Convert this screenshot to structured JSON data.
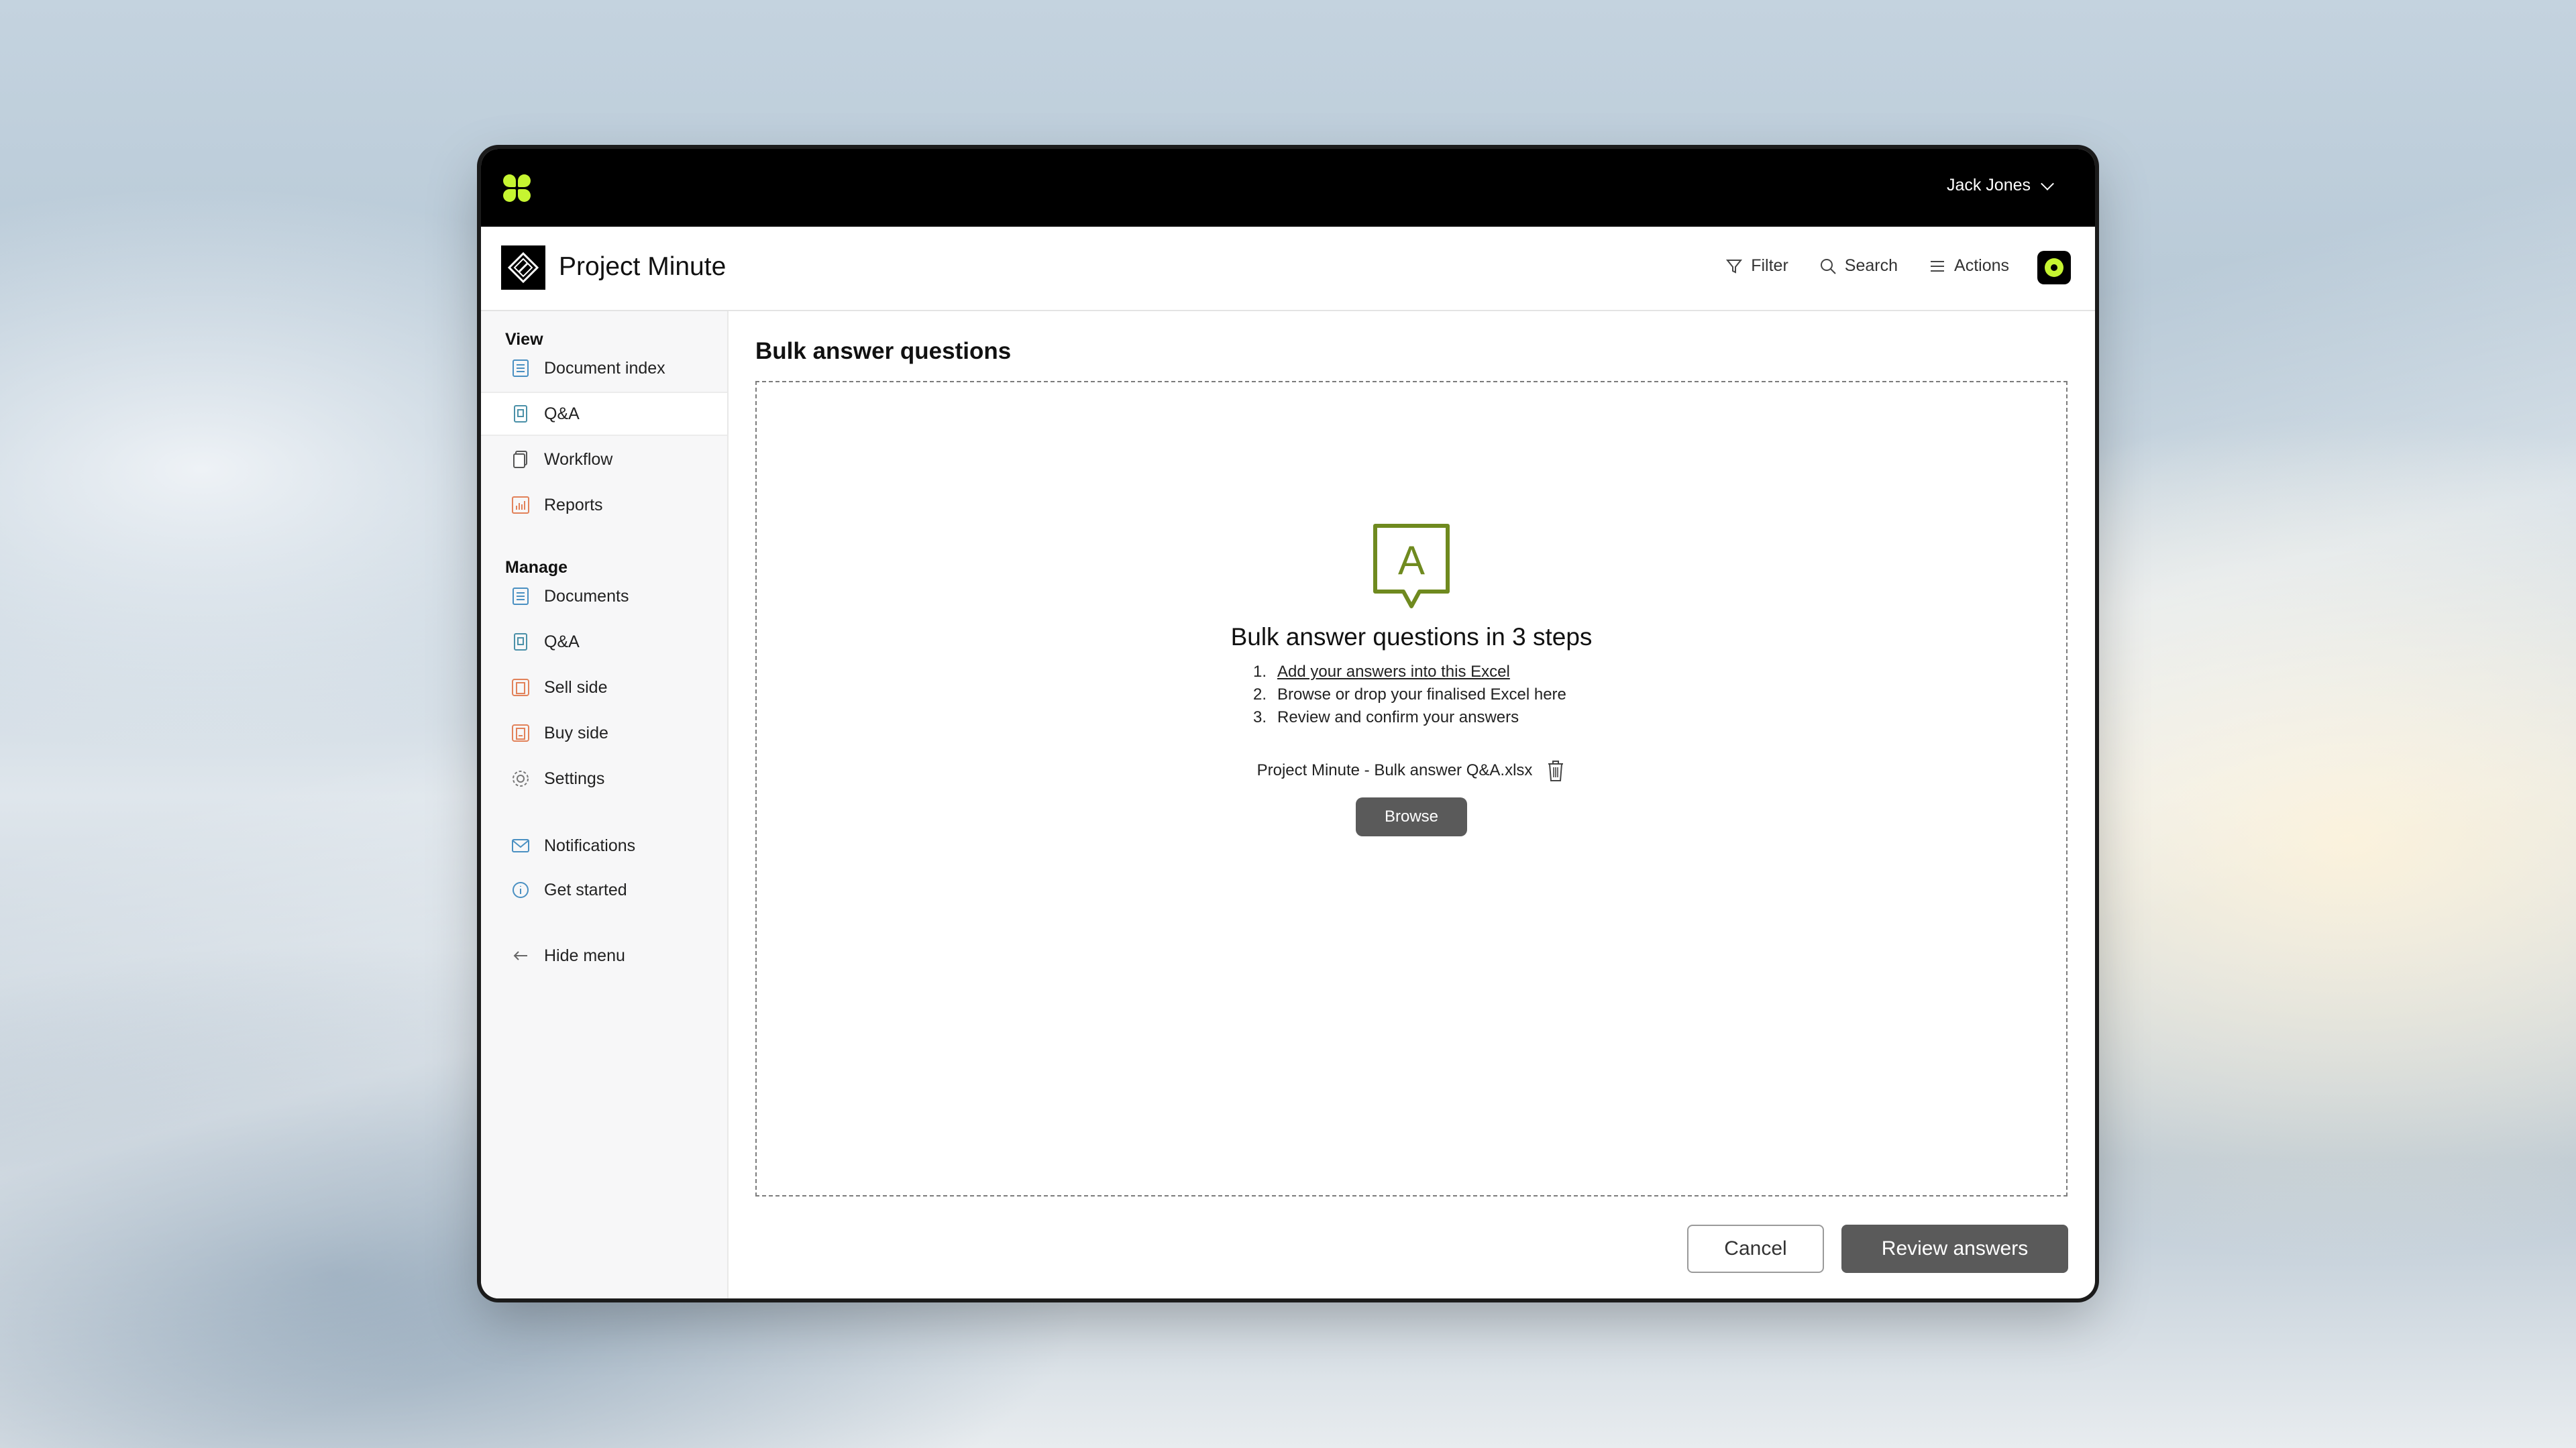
{
  "topbar": {
    "user_name": "Jack Jones"
  },
  "project": {
    "title": "Project Minute"
  },
  "tools": {
    "filter": "Filter",
    "search": "Search",
    "actions": "Actions"
  },
  "sidebar": {
    "view_heading": "View",
    "view_items": [
      {
        "label": "Document index",
        "icon": "document-index-icon"
      },
      {
        "label": "Q&A",
        "icon": "qa-icon"
      },
      {
        "label": "Workflow",
        "icon": "workflow-icon"
      },
      {
        "label": "Reports",
        "icon": "reports-icon"
      }
    ],
    "manage_heading": "Manage",
    "manage_items": [
      {
        "label": "Documents",
        "icon": "documents-icon"
      },
      {
        "label": "Q&A",
        "icon": "qa-icon"
      },
      {
        "label": "Sell side",
        "icon": "sell-side-icon"
      },
      {
        "label": "Buy side",
        "icon": "buy-side-icon"
      },
      {
        "label": "Settings",
        "icon": "settings-icon"
      }
    ],
    "notifications": "Notifications",
    "get_started": "Get started",
    "hide_menu": "Hide menu"
  },
  "main": {
    "title": "Bulk answer questions",
    "heading": "Bulk answer questions in 3 steps",
    "icon_letter": "A",
    "steps": [
      {
        "num": "1.",
        "text": "Add your answers into this Excel"
      },
      {
        "num": "2.",
        "text": "Browse or drop your finalised Excel here"
      },
      {
        "num": "3.",
        "text": "Review and confirm your answers"
      }
    ],
    "file_name": "Project Minute - Bulk answer Q&A.xlsx",
    "browse_label": "Browse"
  },
  "footer": {
    "cancel_label": "Cancel",
    "review_label": "Review answers"
  },
  "colors": {
    "accent": "#c6f531",
    "icon_green": "#6f8a1f",
    "button_dark": "#5a5a5a"
  }
}
